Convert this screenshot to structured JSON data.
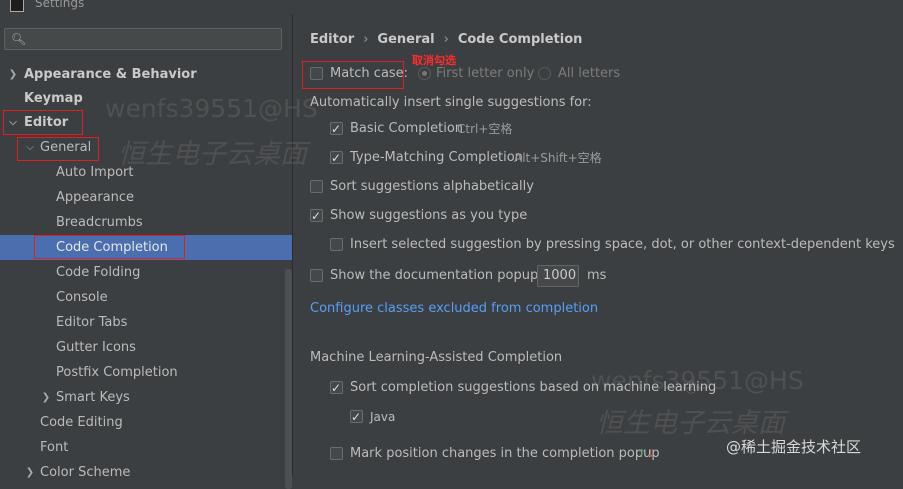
{
  "window": {
    "title": "Settings"
  },
  "search": {
    "placeholder": "",
    "icon": "search-icon"
  },
  "tree": {
    "appearance_behavior": "Appearance & Behavior",
    "keymap": "Keymap",
    "editor": "Editor",
    "general": "General",
    "general_children": [
      "Auto Import",
      "Appearance",
      "Breadcrumbs",
      "Code Completion",
      "Code Folding",
      "Console",
      "Editor Tabs",
      "Gutter Icons",
      "Postfix Completion",
      "Smart Keys"
    ],
    "code_editing": "Code Editing",
    "font": "Font",
    "color_scheme": "Color Scheme"
  },
  "breadcrumb": [
    "Editor",
    "General",
    "Code Completion"
  ],
  "annotation": {
    "note": "取消勾选"
  },
  "match_case": {
    "label": "Match case:",
    "checked": false,
    "option_first": "First letter only",
    "option_all": "All letters"
  },
  "auto_insert": {
    "heading": "Automatically insert single suggestions for:",
    "basic": {
      "label": "Basic Completion",
      "shortcut": "Ctrl+空格",
      "checked": true
    },
    "type_matching": {
      "label": "Type-Matching Completion",
      "shortcut": "Alt+Shift+空格",
      "checked": true
    }
  },
  "sort_alpha": {
    "label": "Sort suggestions alphabetically",
    "checked": false
  },
  "show_as_type": {
    "label": "Show suggestions as you type",
    "checked": true
  },
  "insert_selected": {
    "label": "Insert selected suggestion by pressing space, dot, or other context-dependent keys",
    "checked": false
  },
  "doc_popup": {
    "label": "Show the documentation popup in",
    "value": "1000",
    "unit": "ms",
    "checked": false
  },
  "configure_link": "Configure classes excluded from completion",
  "ml": {
    "heading": "Machine Learning-Assisted Completion",
    "sort_ml": {
      "label": "Sort completion suggestions based on machine learning",
      "checked": true
    },
    "java": {
      "label": "Java",
      "checked": true
    },
    "mark_position": {
      "label": "Mark position changes in the completion popup",
      "checked": false,
      "icon_up": "↑",
      "icon_down": "↓"
    }
  },
  "watermarks": {
    "id_top": "wenfs39551@HS",
    "cn_top": "恒生电子云桌面",
    "id_bottom": "wenfs39551@HS",
    "cn_bottom": "恒生电子云桌面"
  },
  "juejin": "@稀土掘金技术社区",
  "colors": {
    "background": "#3c3f41",
    "selection": "#4b6eaf",
    "link": "#589df6",
    "annotation": "#e02020"
  }
}
